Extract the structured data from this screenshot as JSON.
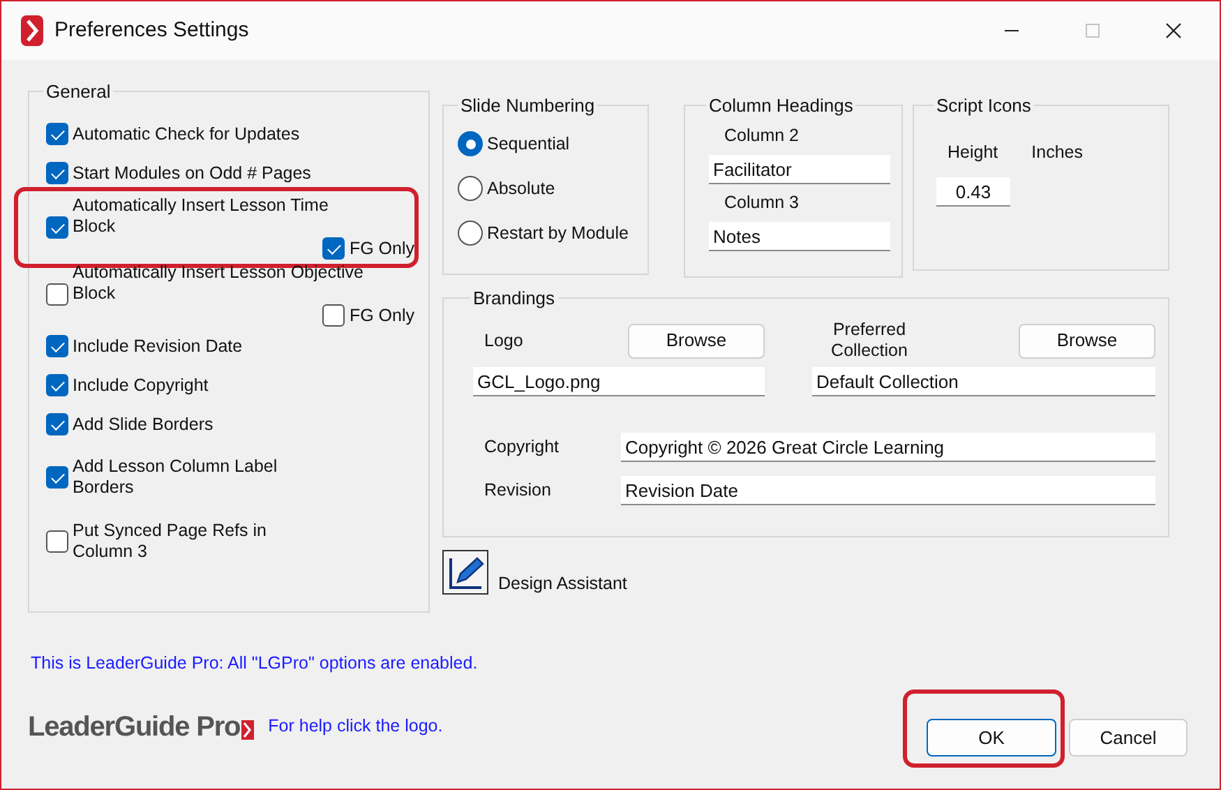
{
  "window": {
    "title": "Preferences Settings",
    "controls": [
      {
        "kind": "minimize",
        "disabled": false
      },
      {
        "kind": "maximize",
        "disabled": true
      },
      {
        "kind": "close",
        "disabled": false
      }
    ]
  },
  "general": {
    "title": "General",
    "items": [
      {
        "label": "Automatic Check for Updates",
        "checked": true,
        "highlighted": false
      },
      {
        "label": "Start Modules on Odd # Pages",
        "checked": true,
        "highlighted": false
      },
      {
        "label": "Automatically Insert Lesson Time\nBlock",
        "checked": true,
        "highlighted": true,
        "sub": {
          "label": "FG Only",
          "checked": true
        }
      },
      {
        "label": "Automatically Insert Lesson Objective\nBlock",
        "checked": false,
        "highlighted": false,
        "sub": {
          "label": "FG Only",
          "checked": false
        }
      },
      {
        "label": "Include Revision Date",
        "checked": true,
        "highlighted": false
      },
      {
        "label": "Include Copyright",
        "checked": true,
        "highlighted": false
      },
      {
        "label": "Add Slide Borders",
        "checked": true,
        "highlighted": false
      },
      {
        "label": "Add Lesson Column Label\nBorders",
        "checked": true,
        "highlighted": false
      },
      {
        "label": "Put Synced Page Refs in\nColumn 3",
        "checked": false,
        "highlighted": false
      }
    ]
  },
  "slide_numbering": {
    "title": "Slide Numbering",
    "options": [
      {
        "label": "Sequential",
        "selected": true
      },
      {
        "label": "Absolute",
        "selected": false
      },
      {
        "label": "Restart by Module",
        "selected": false
      }
    ]
  },
  "column_headings": {
    "title": "Column Headings",
    "columns": [
      {
        "label": "Column 2",
        "value": "Facilitator"
      },
      {
        "label": "Column 3",
        "value": "Notes"
      }
    ]
  },
  "script_icons": {
    "title": "Script Icons",
    "height_label": "Height",
    "unit": "Inches",
    "height_value": "0.43"
  },
  "brandings": {
    "title": "Brandings",
    "logo": {
      "label": "Logo",
      "button": "Browse",
      "value": "GCL_Logo.png"
    },
    "collection": {
      "label": "Preferred\nCollection",
      "button": "Browse",
      "value": "Default Collection"
    },
    "fields": [
      {
        "label": "Copyright",
        "value": "Copyright © 2026 Great Circle Learning"
      },
      {
        "label": "Revision",
        "value": "Revision Date"
      }
    ]
  },
  "design_assistant": {
    "label": "Design Assistant"
  },
  "info": "This is LeaderGuide Pro: All \"LGPro\" options are enabled.",
  "footer": {
    "logo_text": "LeaderGuide Pro",
    "help": "For help click the logo."
  },
  "buttons": [
    {
      "label": "OK",
      "default": true,
      "highlighted": true
    },
    {
      "label": "Cancel",
      "default": false,
      "highlighted": false
    }
  ]
}
